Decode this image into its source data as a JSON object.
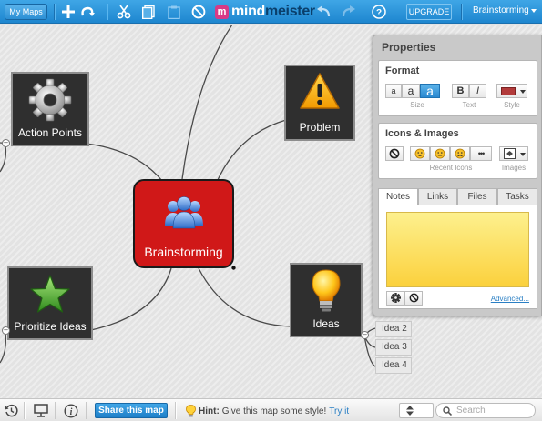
{
  "toolbar": {
    "my_maps": "My Maps",
    "logo_mark": "m",
    "logo_part1": "mind",
    "logo_part2": "meister",
    "upgrade": "UPGRADE",
    "map_title": "Brainstorming",
    "icons": [
      "add-icon",
      "reconnect-icon",
      "cut-icon",
      "copy-icon",
      "paste-icon",
      "delete-icon",
      "undo-icon",
      "redo-icon",
      "help-icon"
    ]
  },
  "map": {
    "central": "Brainstorming",
    "nodes": [
      {
        "label": "Action Points",
        "icon": "gear-icon"
      },
      {
        "label": "Problem",
        "icon": "warning-icon"
      },
      {
        "label": "Prioritize Ideas",
        "icon": "star-icon"
      },
      {
        "label": "Ideas",
        "icon": "lightbulb-icon"
      }
    ],
    "subtopics": [
      "Idea 2",
      "Idea 3",
      "Idea 4"
    ]
  },
  "properties": {
    "title": "Properties",
    "format": {
      "title": "Format",
      "size_small": "a",
      "size_medium": "a",
      "size_large": "a",
      "bold": "B",
      "italic": "I",
      "size_label": "Size",
      "text_label": "Text",
      "style_label": "Style",
      "style_color": "#b23a3a"
    },
    "icons_images": {
      "title": "Icons & Images",
      "recent_label": "Recent Icons",
      "images_label": "Images",
      "more": "•••"
    },
    "tabs": [
      "Notes",
      "Links",
      "Files",
      "Tasks"
    ],
    "active_tab": "Notes",
    "advanced": "Advanced..."
  },
  "bottombar": {
    "share": "Share this map",
    "hint_label": "Hint:",
    "hint_text": "Give this map some style!",
    "hint_link": "Try it",
    "search_placeholder": "Search"
  },
  "colors": {
    "toolbar_blue": "#2391da",
    "central_red": "#d01818",
    "note_yellow": "#fbd13d"
  }
}
